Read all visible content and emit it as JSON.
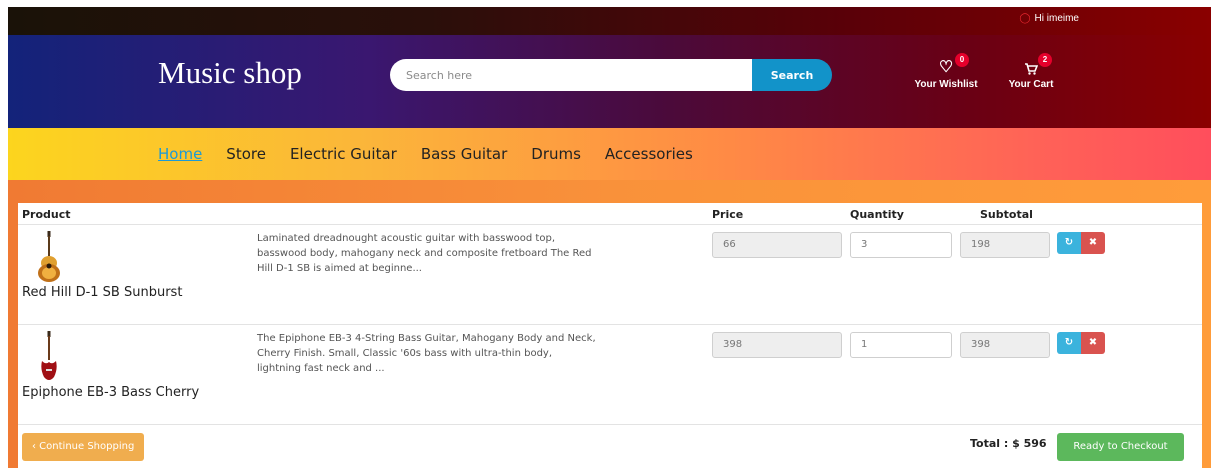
{
  "topbar": {
    "greeting": "Hi imeime",
    "user_icon": "user-icon"
  },
  "header": {
    "logo": "Music shop",
    "search": {
      "placeholder": "Search here",
      "button_label": "Search"
    },
    "wishlist": {
      "label": "Your Wishlist",
      "count": "0",
      "icon": "heart-icon"
    },
    "cart": {
      "label": "Your Cart",
      "count": "2",
      "icon": "cart-icon"
    }
  },
  "nav": {
    "items": [
      {
        "label": "Home",
        "active": true
      },
      {
        "label": "Store"
      },
      {
        "label": "Electric Guitar"
      },
      {
        "label": "Bass Guitar"
      },
      {
        "label": "Drums"
      },
      {
        "label": "Accessories"
      }
    ]
  },
  "cart_table": {
    "columns": {
      "product": "Product",
      "price": "Price",
      "quantity": "Quantity",
      "subtotal": "Subtotal"
    },
    "rows": [
      {
        "name": "Red Hill D-1 SB Sunburst",
        "description": "Laminated dreadnought acoustic guitar with basswood top, basswood body, mahogany neck and composite fretboard The Red Hill D-1 SB is aimed at beginne...",
        "price": "66",
        "quantity": "3",
        "subtotal": "198"
      },
      {
        "name": "Epiphone EB-3 Bass Cherry",
        "description": "The Epiphone EB-3 4-String Bass Guitar, Mahogany Body and Neck, Cherry Finish. Small, Classic '60s bass with ultra-thin body, lightning fast neck and ...",
        "price": "398",
        "quantity": "1",
        "subtotal": "398"
      }
    ]
  },
  "footer": {
    "continue_label": "‹ Continue Shopping",
    "total": "Total : $ 596",
    "checkout_label": "Ready to Checkout"
  },
  "colors": {
    "accent_blue": "#1293c9",
    "nav_active": "#1c9ad6",
    "refresh": "#3bb3dd",
    "delete": "#d9534f",
    "continue": "#f0ad4e",
    "checkout": "#5cb85c",
    "badge": "#e5002b"
  }
}
